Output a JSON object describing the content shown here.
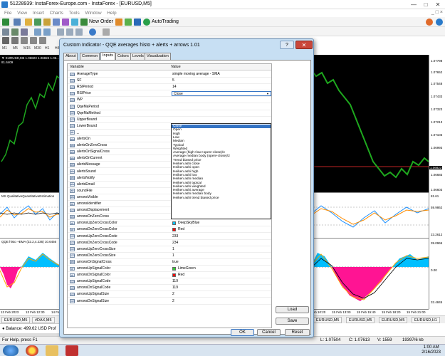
{
  "window": {
    "title": "51228939: InstaForex-Europe.com - InstaForex - [EURUSD,M5]",
    "controls": [
      "—",
      "□",
      "✕"
    ]
  },
  "menu": {
    "items": [
      "File",
      "View",
      "Insert",
      "Charts",
      "Tools",
      "Window",
      "Help"
    ],
    "right_controls": "_ □ ×"
  },
  "toolbar": {
    "new_order": "New Order",
    "autotrading": "AutoTrading"
  },
  "timeframes": [
    "M1",
    "M5",
    "M15",
    "M30",
    "H1",
    "H4"
  ],
  "chart_left": {
    "label1": "▼ EURUSD,M5 1.06823 1.06824 1.06...",
    "label1b": "81.6409",
    "label2": "MS QualitativeQuantitativeEstimation",
    "label3": "QQE histo +EMA (32.2,4.236) 10.6456"
  },
  "price_axis": {
    "prices": [
      "1.07798",
      "1.07652",
      "1.07548",
      "1.07433",
      "1.07323",
      "1.07213",
      "1.07103",
      "1.06993",
      "1.06823",
      "1.06683",
      "1.06603",
      "81.61",
      "59.9862",
      "23.2612",
      "39.0965",
      "0.00",
      "32.4845"
    ],
    "highlight": "1.06823"
  },
  "time_axis": {
    "left": [
      "13 Feb 2023",
      "13 Feb 12:30",
      "14 Feb"
    ],
    "right": [
      "Feb 10:20",
      "15 Feb 13:00",
      "15 Feb 15:40",
      "15 Feb 18:20",
      "15 Feb 21:00"
    ]
  },
  "chart_tabs": [
    "EURUSD,M5",
    "#DAX,M5",
    "EURUSD,M5",
    "EURUSD,M5",
    "EURUSD,M5",
    "EURUSD,H1"
  ],
  "balance": "● Balance: 499.62 USD  Prof",
  "status": {
    "help": "For Help, press F1",
    "low": "L: 1.07504",
    "close": "C: 1.07613",
    "volume": "V: 1559",
    "traffic": "19397/6 kb"
  },
  "clock": {
    "time": "1:00 AM",
    "date": "2/16/2023"
  },
  "dialog": {
    "title": "Custom Indicator - QQE averages histo + alerts + arrows 1.01",
    "help": "?",
    "close": "✕",
    "tabs": [
      "About",
      "Common",
      "Inputs",
      "Colors",
      "Levels",
      "Visualization"
    ],
    "active_tab": "Inputs",
    "col_variable": "Variable",
    "col_value": "Value",
    "rows": [
      {
        "icon": "123",
        "name": "AverageType",
        "value": "simple moving average - SMA"
      },
      {
        "icon": "123",
        "name": "SF",
        "value": "5"
      },
      {
        "icon": "123",
        "name": "RSIPeriod",
        "value": "14"
      },
      {
        "icon": "123",
        "name": "RSIPrice",
        "value": "Close"
      },
      {
        "icon": "123",
        "name": "WP",
        "value": ""
      },
      {
        "icon": "123",
        "name": "QqeMaPeriod",
        "value": ""
      },
      {
        "icon": "123",
        "name": "QqeMaMethod",
        "value": ""
      },
      {
        "icon": "123",
        "name": "UpperBound",
        "value": ""
      },
      {
        "icon": "123",
        "name": "LowerBound",
        "value": ""
      },
      {
        "icon": "ab",
        "name": "_",
        "value": ""
      },
      {
        "icon": "abc",
        "name": "alertsOn",
        "value": ""
      },
      {
        "icon": "abc",
        "name": "alertsOnZeroCross",
        "value": ""
      },
      {
        "icon": "abc",
        "name": "alertsOnSignalCross",
        "value": ""
      },
      {
        "icon": "abc",
        "name": "alertsOnCurrent",
        "value": ""
      },
      {
        "icon": "abc",
        "name": "alertsMessage",
        "value": ""
      },
      {
        "icon": "abc",
        "name": "alertsSound",
        "value": ""
      },
      {
        "icon": "abc",
        "name": "alertsNotify",
        "value": ""
      },
      {
        "icon": "abc",
        "name": "alertsEmail",
        "value": "false"
      },
      {
        "icon": "ab",
        "name": "soundFile",
        "value": "alert2.wav"
      },
      {
        "icon": "abc",
        "name": "arrowsVisible",
        "value": "false"
      },
      {
        "icon": "ab",
        "name": "arrowsIdentifier",
        "value": "qqe Arrows1"
      },
      {
        "icon": "123",
        "name": "arrowsDisplacement",
        "value": "1.0"
      },
      {
        "icon": "abc",
        "name": "arrowsOnZeroCross",
        "value": "false"
      },
      {
        "icon": "clr",
        "name": "arrowsUpZeroCrossColor",
        "value": "DeepSkyBlue",
        "color": "#00bfff"
      },
      {
        "icon": "clr",
        "name": "arrowsDnZeroCrossColor",
        "value": "Red",
        "color": "#ff0000"
      },
      {
        "icon": "123",
        "name": "arrowsUpZeroCrossCode",
        "value": "233"
      },
      {
        "icon": "123",
        "name": "arrowsDnZeroCrossCode",
        "value": "234"
      },
      {
        "icon": "123",
        "name": "arrowsUpZeroCrossSize",
        "value": "1"
      },
      {
        "icon": "123",
        "name": "arrowsDnZeroCrossSize",
        "value": "1"
      },
      {
        "icon": "abc",
        "name": "arrowsOnSignalCross",
        "value": "true"
      },
      {
        "icon": "clr",
        "name": "arrowsUpSignalColor",
        "value": "LimeGreen",
        "color": "#32cd32"
      },
      {
        "icon": "clr",
        "name": "arrowsDnSignalColor",
        "value": "Red",
        "color": "#ff0000"
      },
      {
        "icon": "123",
        "name": "arrowsUpSignalCode",
        "value": "119"
      },
      {
        "icon": "123",
        "name": "arrowsDnSignalCode",
        "value": "119"
      },
      {
        "icon": "123",
        "name": "arrowsUpSignalSize",
        "value": "2"
      },
      {
        "icon": "123",
        "name": "arrowsDnSignalSize",
        "value": "2"
      }
    ],
    "dropdown": {
      "selected": "Close",
      "options": [
        "Close",
        "Open",
        "High",
        "Low",
        "Median",
        "Typical",
        "Weighted",
        "Average (high+low+open+close)/4",
        "Average median body (open+close)/2",
        "Trend biased price",
        "Heiken ashi close",
        "Heiken ashi open",
        "Heiken ashi high",
        "Heiken ashi low",
        "Heiken ashi median",
        "Heiken ashi typical",
        "Heiken ashi weighted",
        "Heiken ashi average",
        "Heiken ashi median body",
        "Heiken ashi trend biased price"
      ]
    },
    "buttons": {
      "load": "Load",
      "save": "Save",
      "ok": "OK",
      "cancel": "Cancel",
      "reset": "Reset"
    }
  }
}
